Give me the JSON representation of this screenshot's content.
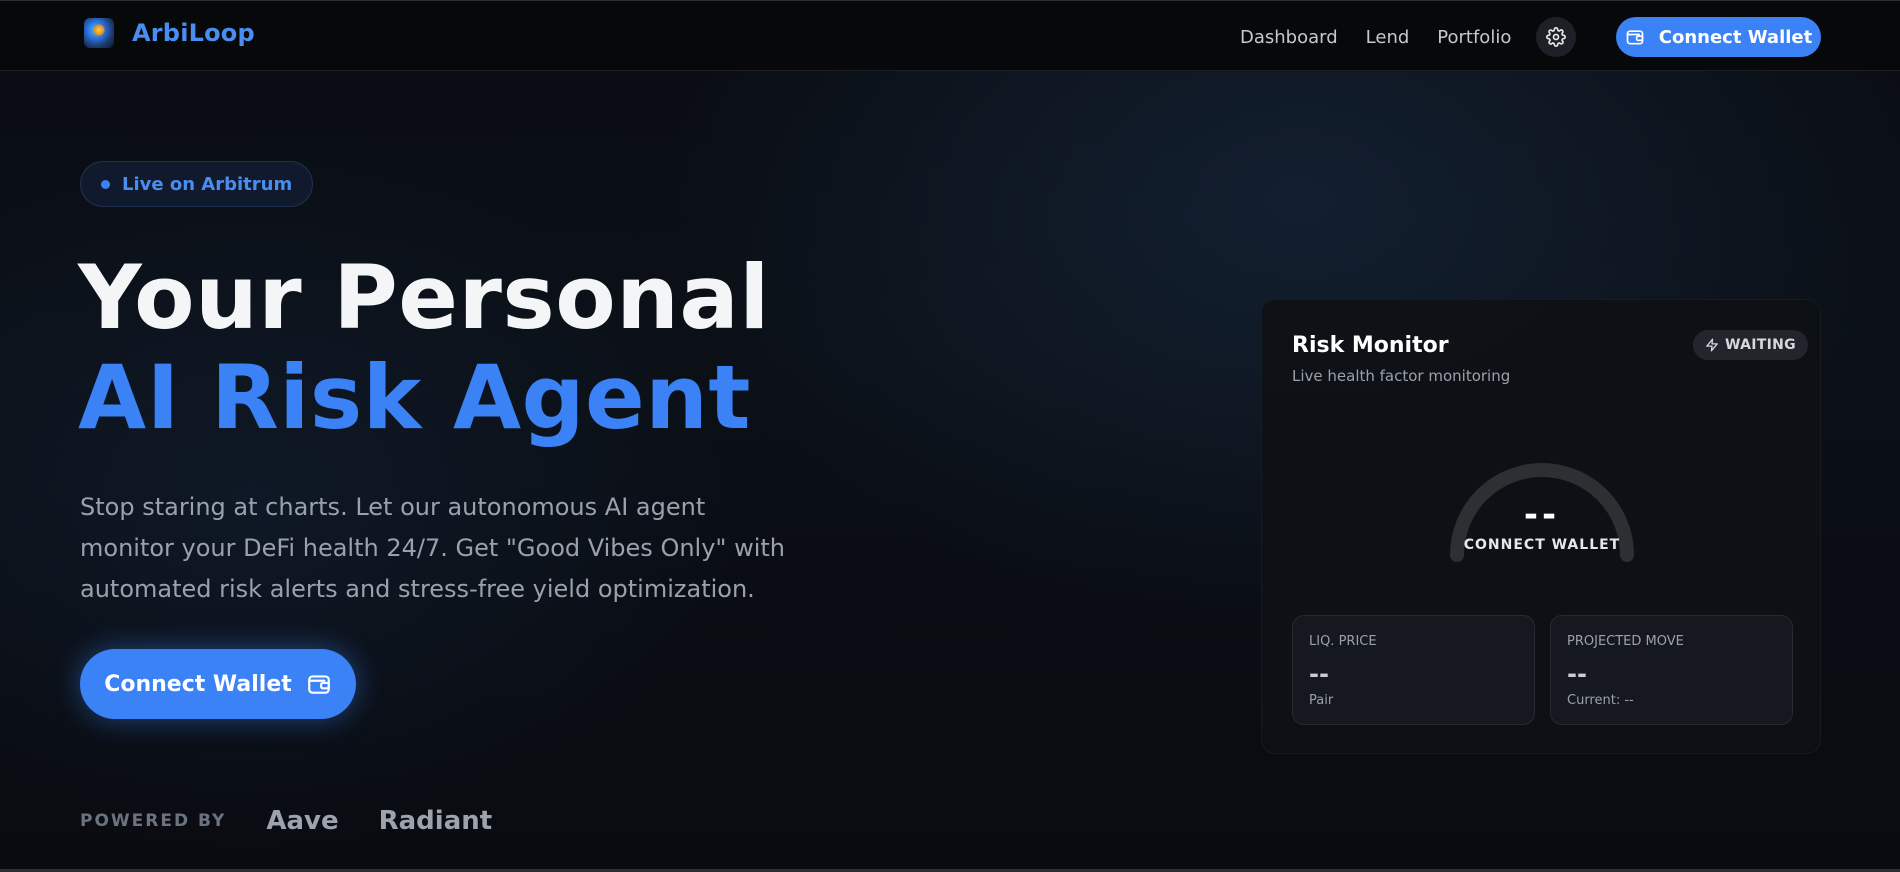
{
  "nav": {
    "brand": "ArbiLoop",
    "links": [
      "Dashboard",
      "Lend",
      "Portfolio"
    ],
    "settings_icon": "gear-icon",
    "connect_label": "Connect Wallet"
  },
  "hero": {
    "badge": "Live on Arbitrum",
    "title_line1": "Your Personal",
    "title_line2": "AI Risk Agent",
    "description": "Stop staring at charts. Let our autonomous AI agent monitor your DeFi health 24/7. Get \"Good Vibes Only\" with automated risk alerts and stress-free yield optimization.",
    "cta_label": "Connect Wallet",
    "powered_by_label": "POWERED BY",
    "partners": [
      "Aave",
      "Radiant"
    ]
  },
  "risk_monitor": {
    "title": "Risk Monitor",
    "subtitle": "Live health factor monitoring",
    "status": "WAITING",
    "gauge_value": "--",
    "gauge_label": "CONNECT WALLET",
    "stats": [
      {
        "label": "LIQ. PRICE",
        "value": "--",
        "foot": "Pair"
      },
      {
        "label": "PROJECTED MOVE",
        "value": "--",
        "foot": "Current: --"
      }
    ]
  },
  "colors": {
    "accent": "#3b82f6",
    "background": "#0a0d13",
    "card": "#0e1015"
  }
}
